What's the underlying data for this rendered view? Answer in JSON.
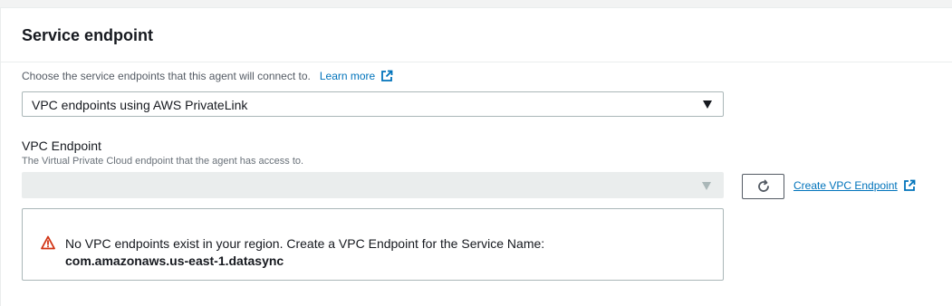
{
  "panel": {
    "title": "Service endpoint"
  },
  "endpoint_type": {
    "description": "Choose the service endpoints that this agent will connect to.",
    "learn_more_label": "Learn more",
    "selected_value": "VPC endpoints using AWS PrivateLink"
  },
  "vpc_endpoint": {
    "label": "VPC Endpoint",
    "description": "The Virtual Private Cloud endpoint that the agent has access to.",
    "selected_value": "",
    "create_link_label": "Create VPC Endpoint"
  },
  "alert": {
    "icon": "warning-icon",
    "message": "No VPC endpoints exist in your region. Create a VPC Endpoint for the Service Name:",
    "service_name": "com.amazonaws.us-east-1.datasync"
  },
  "colors": {
    "link": "#0073bb",
    "warning": "#d13212",
    "border": "#aab7b8",
    "disabled_bg": "#eaeded"
  }
}
